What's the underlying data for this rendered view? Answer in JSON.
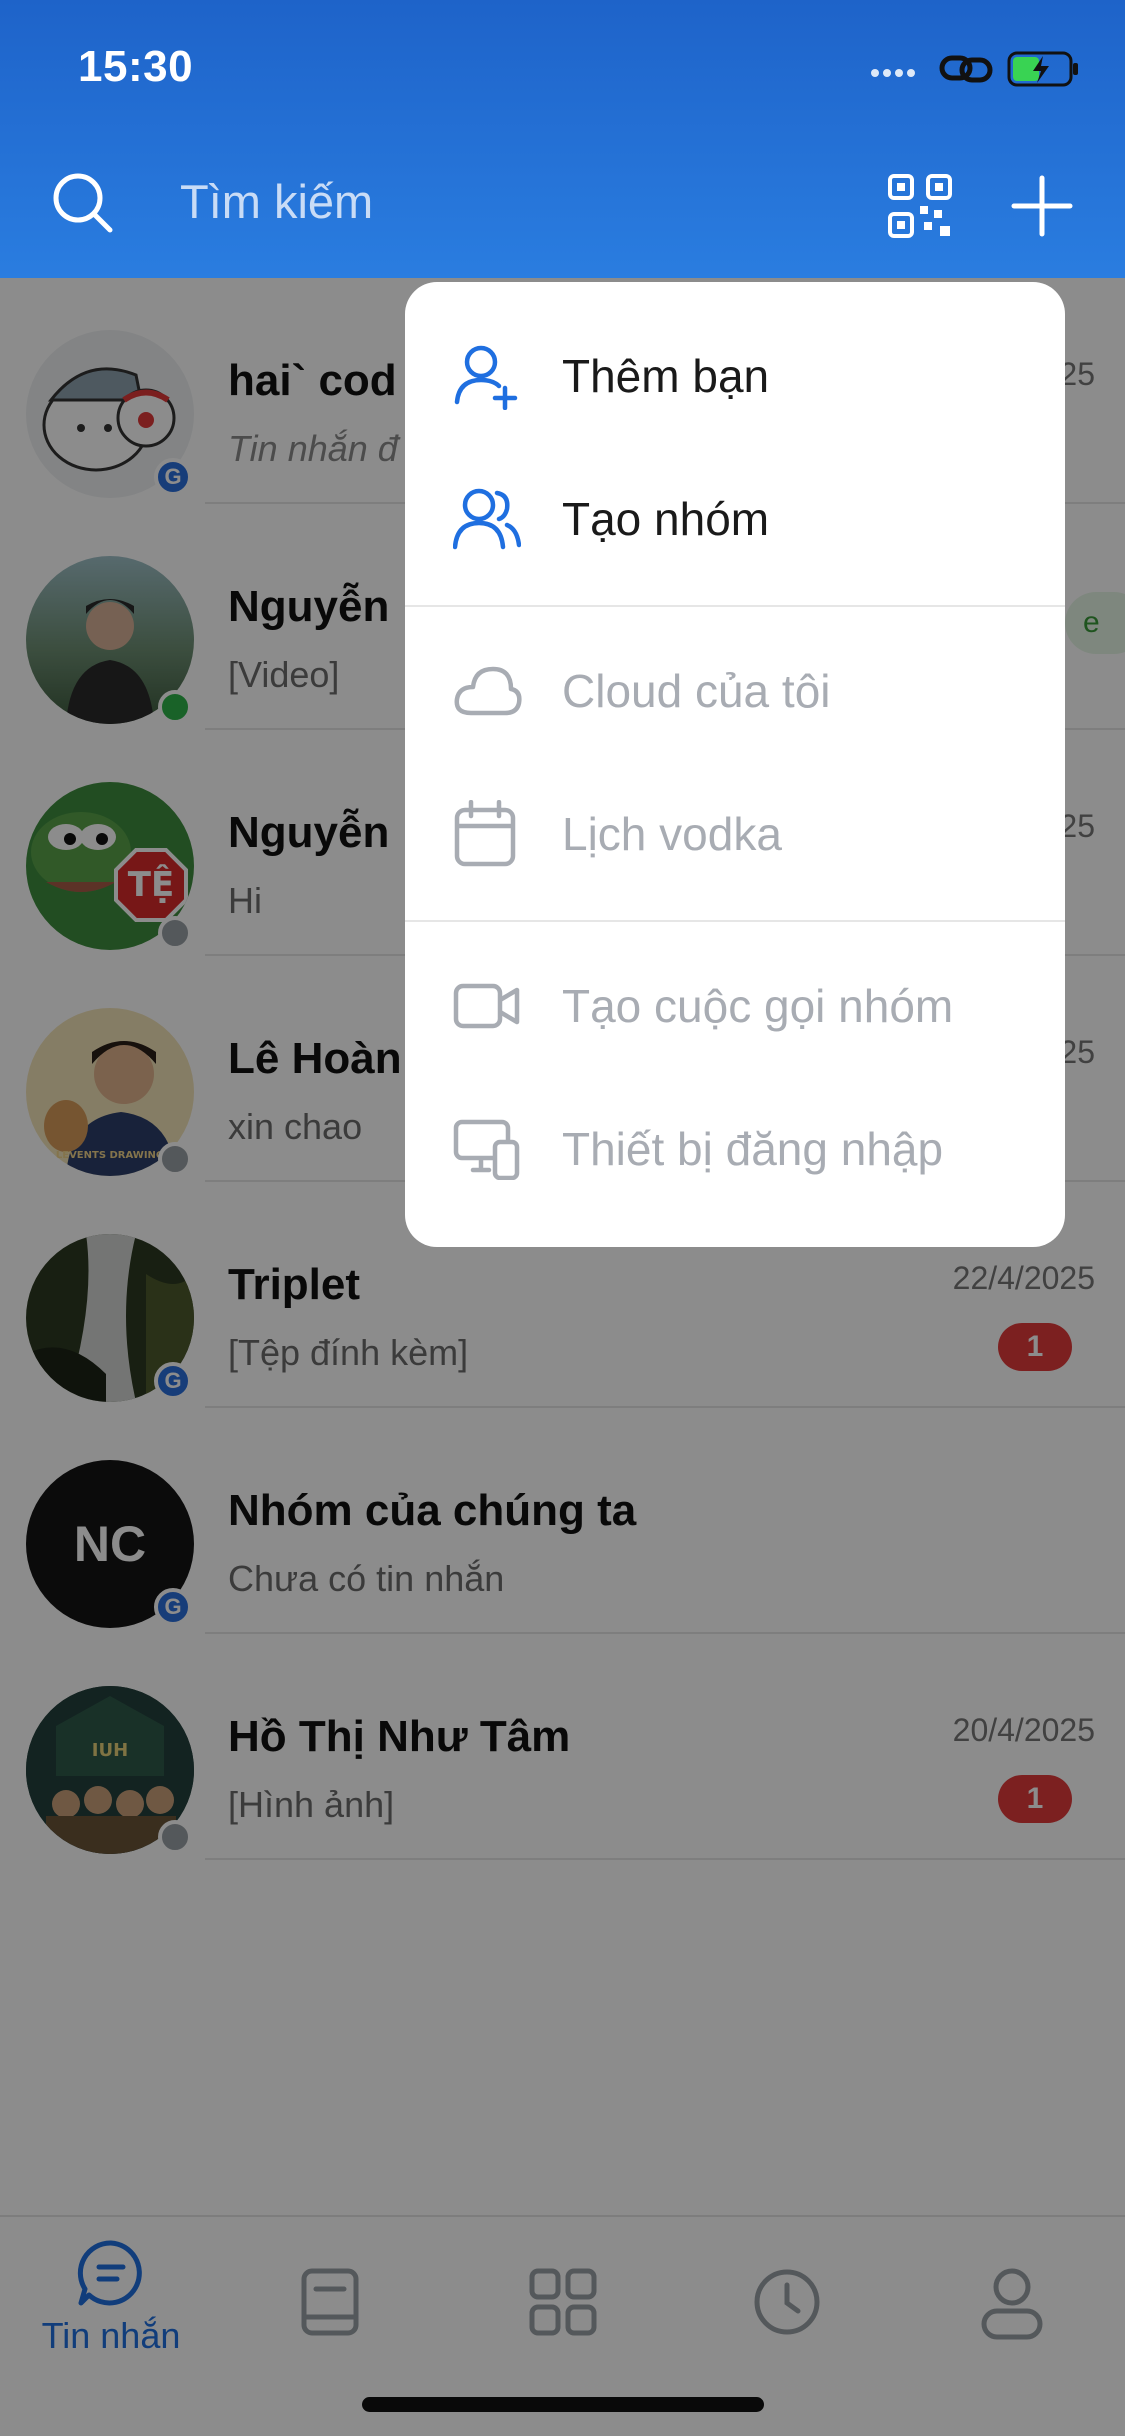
{
  "status_bar": {
    "time": "15:30"
  },
  "search": {
    "placeholder": "Tìm kiếm"
  },
  "conversations": [
    {
      "name": "hai` cod",
      "preview": "Tin nhắn đ",
      "time": "25",
      "badge": "G",
      "italic": true
    },
    {
      "name": "Nguyễn",
      "preview": "[Video]",
      "time": "",
      "badge": "online",
      "pill": "e"
    },
    {
      "name": "Nguyễn",
      "preview": "Hi",
      "time": "25",
      "badge": "offline"
    },
    {
      "name": "Lê Hoàn",
      "preview": "xin chao",
      "time": "25",
      "badge": "offline"
    },
    {
      "name": "Triplet",
      "preview": "[Tệp đính kèm]",
      "time": "22/4/2025",
      "badge": "G",
      "unread": "1"
    },
    {
      "name": "Nhóm của chúng ta",
      "preview": "Chưa có tin nhắn",
      "time": "",
      "badge": "G",
      "initials": "NC"
    },
    {
      "name": "Hồ Thị Như Tâm",
      "preview": "[Hình ảnh]",
      "time": "20/4/2025",
      "badge": "offline",
      "unread": "1"
    }
  ],
  "avatar_texts": {
    "row3": "TỆ",
    "row4": "LEVENTS DRAWING",
    "row7": "IUH"
  },
  "dropdown_menu": {
    "items": [
      {
        "label": "Thêm bạn",
        "icon": "add-friend-icon",
        "enabled": true
      },
      {
        "label": "Tạo nhóm",
        "icon": "create-group-icon",
        "enabled": true
      },
      {
        "label": "Cloud của tôi",
        "icon": "cloud-icon",
        "enabled": false
      },
      {
        "label": "Lịch vodka",
        "icon": "calendar-icon",
        "enabled": false
      },
      {
        "label": "Tạo cuộc gọi nhóm",
        "icon": "video-call-icon",
        "enabled": false
      },
      {
        "label": "Thiết bị đăng nhập",
        "icon": "devices-icon",
        "enabled": false
      }
    ]
  },
  "tabbar": {
    "tabs": [
      {
        "label": "Tin nhắn",
        "icon": "messages-icon",
        "active": true
      },
      {
        "label": "",
        "icon": "contacts-icon",
        "active": false
      },
      {
        "label": "",
        "icon": "discover-icon",
        "active": false
      },
      {
        "label": "",
        "icon": "timeline-icon",
        "active": false
      },
      {
        "label": "",
        "icon": "profile-icon",
        "active": false
      }
    ]
  },
  "colors": {
    "header": "#2a7de0",
    "accent": "#1f6fe0",
    "unread": "#e23b3b",
    "online": "#2fb34a",
    "offline": "#9aa0a6"
  }
}
